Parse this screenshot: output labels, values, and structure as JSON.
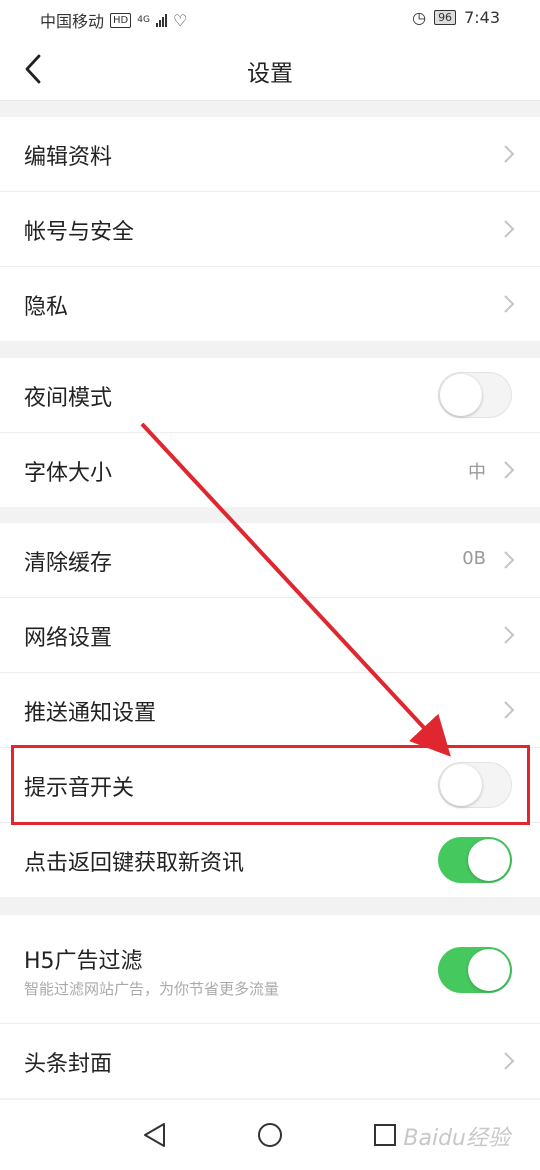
{
  "status_bar": {
    "carrier": "中国移动",
    "hd": "HD",
    "network": "4G",
    "battery": "96",
    "time": "7:43"
  },
  "nav": {
    "title": "设置"
  },
  "groups": [
    {
      "items": [
        {
          "label": "编辑资料"
        },
        {
          "label": "帐号与安全"
        },
        {
          "label": "隐私"
        }
      ]
    },
    {
      "items": [
        {
          "label": "夜间模式",
          "toggle": "off"
        },
        {
          "label": "字体大小",
          "value": "中"
        }
      ]
    },
    {
      "items": [
        {
          "label": "清除缓存",
          "value": "0B"
        },
        {
          "label": "网络设置"
        },
        {
          "label": "推送通知设置"
        },
        {
          "label": "提示音开关",
          "toggle": "off"
        },
        {
          "label": "点击返回键获取新资讯",
          "toggle": "on"
        }
      ]
    },
    {
      "items": [
        {
          "label": "H5广告过滤",
          "sub": "智能过滤网站广告，为你节省更多流量",
          "toggle": "on"
        },
        {
          "label": "头条封面"
        }
      ]
    }
  ],
  "watermark": "Baidu经验",
  "colors": {
    "toggle_on": "#45c95e",
    "annotation": "#e0262e"
  }
}
